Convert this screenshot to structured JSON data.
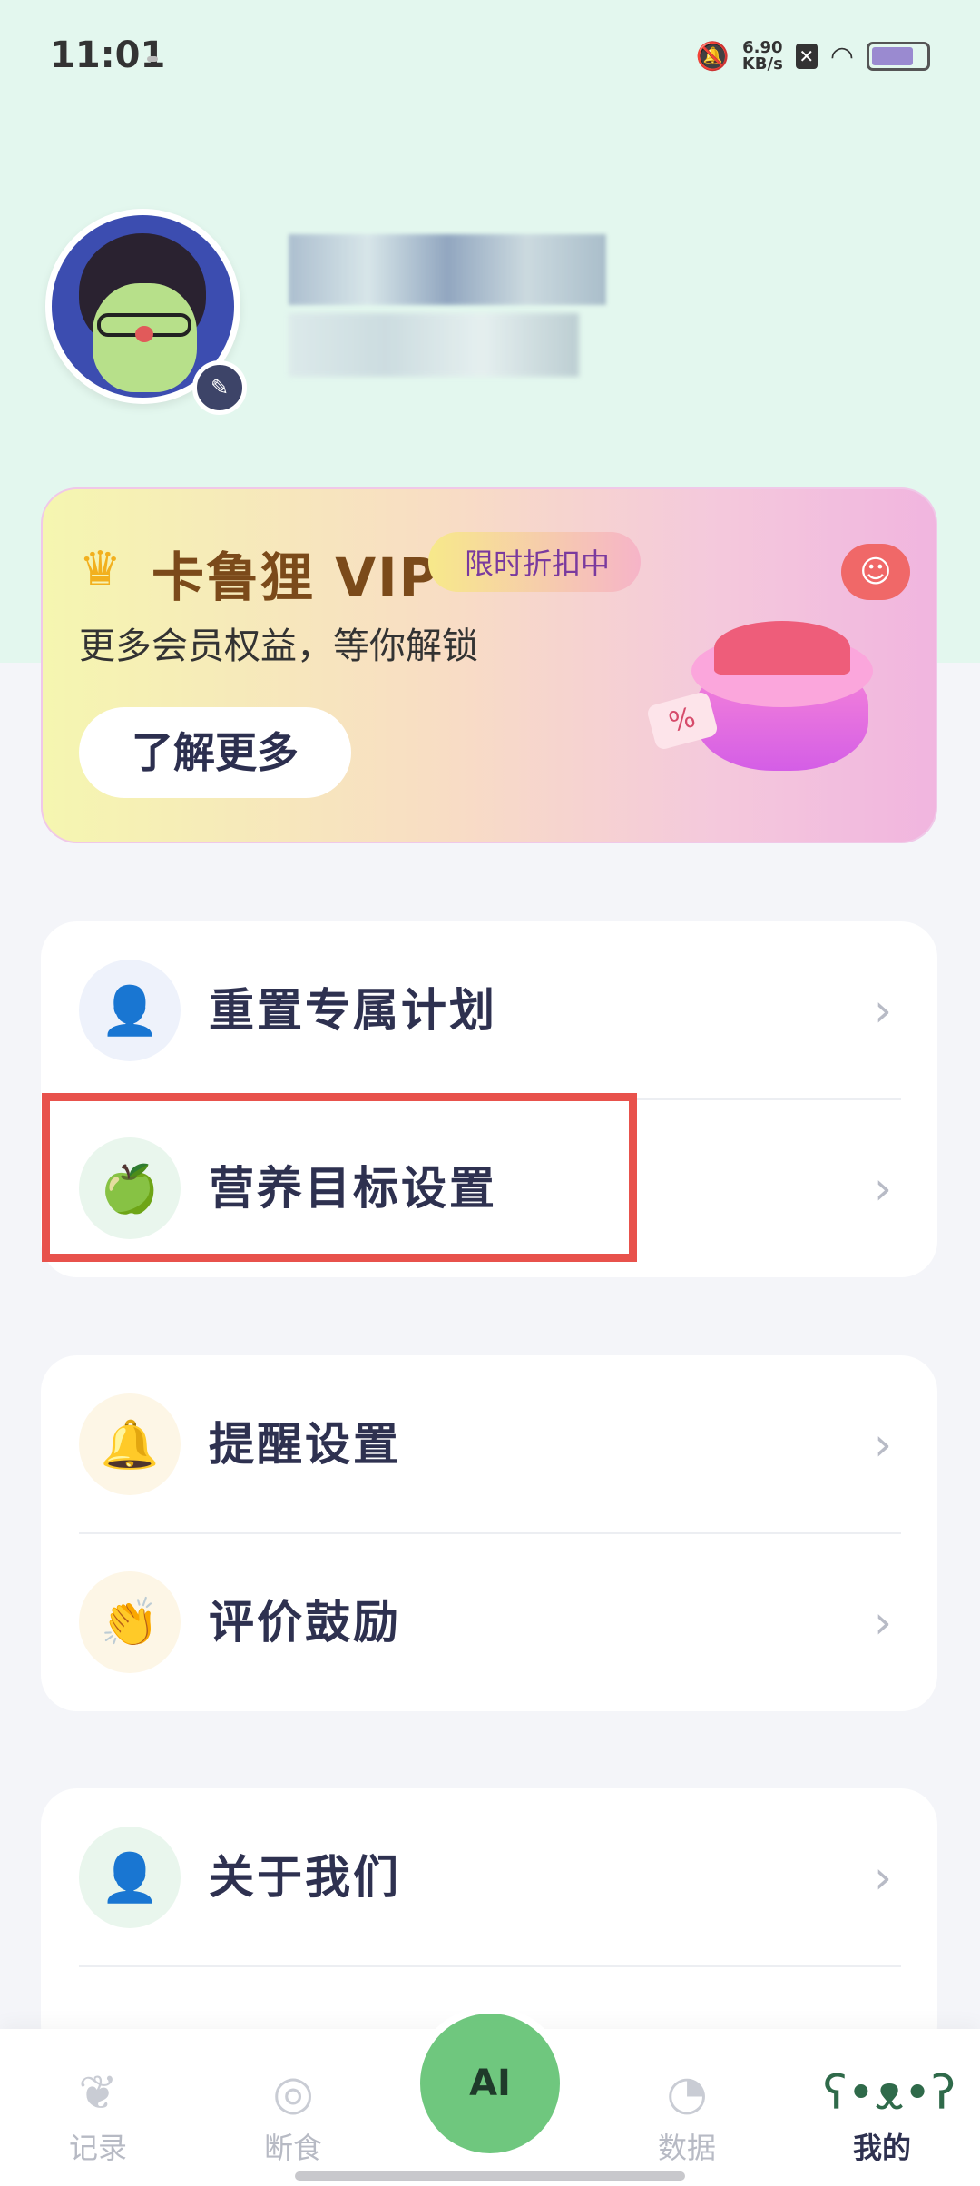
{
  "status_bar": {
    "time": "11:01",
    "network_speed_value": "6.90",
    "network_speed_unit": "KB/s"
  },
  "vip_card": {
    "title": "卡鲁狸 VIP",
    "tag": "限时折扣中",
    "subtitle": "更多会员权益，等你解锁",
    "button": "了解更多",
    "gift_label": "%"
  },
  "menu_groups": [
    {
      "items": [
        {
          "label": "重置专属计划",
          "icon": "person-icon",
          "icon_color": "#5b8ee0",
          "icon_bg": "#eef2fb"
        },
        {
          "label": "营养目标设置",
          "icon": "apple-icon",
          "icon_color": "#4cb36a",
          "icon_bg": "#e9f6ed"
        }
      ]
    },
    {
      "items": [
        {
          "label": "提醒设置",
          "icon": "bell-icon",
          "icon_color": "#f2b33d",
          "icon_bg": "#fdf6e6"
        },
        {
          "label": "评价鼓励",
          "icon": "clap-icon",
          "icon_color": "#f2b33d",
          "icon_bg": "#fdf6e6"
        }
      ]
    },
    {
      "items": [
        {
          "label": "关于我们",
          "icon": "person-icon",
          "icon_color": "#4cb36a",
          "icon_bg": "#e9f6ed"
        }
      ]
    }
  ],
  "tab_bar": {
    "tabs": [
      {
        "label": "记录",
        "icon": "feather-icon",
        "active": false
      },
      {
        "label": "断食",
        "icon": "fasting-icon",
        "active": false
      },
      {
        "label": "AI",
        "icon": "ai-bear-icon",
        "active": false
      },
      {
        "label": "数据",
        "icon": "pie-chart-icon",
        "active": false
      },
      {
        "label": "我的",
        "icon": "bear-face-icon",
        "active": true
      }
    ]
  },
  "colors": {
    "header_bg": "#e3f7ee",
    "page_bg": "#f4f5f9",
    "highlight": "#e8524c",
    "ai_button": "#6fc77e"
  }
}
